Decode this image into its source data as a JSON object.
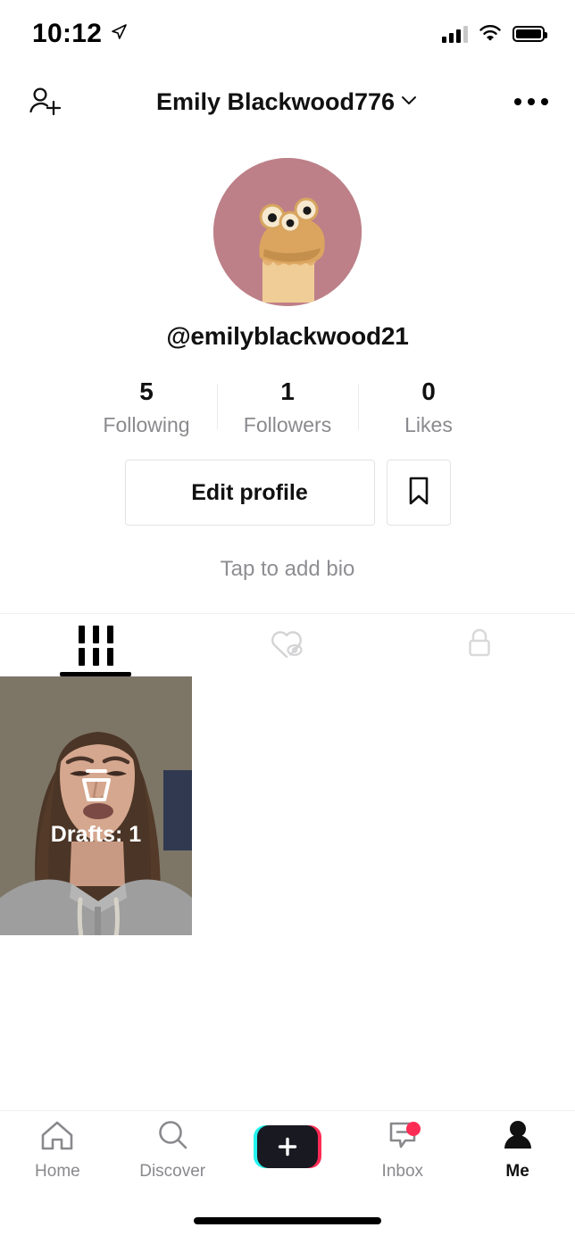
{
  "status_bar": {
    "time": "10:12",
    "location_icon": "location-arrow-icon",
    "signal_icon": "cellular-signal-icon",
    "wifi_icon": "wifi-icon",
    "battery_icon": "battery-full-icon"
  },
  "header": {
    "add_friend_icon": "add-person-icon",
    "title": "Emily Blackwood776",
    "chevron_icon": "chevron-down-icon",
    "more_icon": "more-options-icon"
  },
  "profile": {
    "avatar_icon": "avatar-cartoon-character",
    "avatar_bg_color": "#bd8088",
    "username": "@emilyblackwood21",
    "stats": [
      {
        "value": "5",
        "label": "Following"
      },
      {
        "value": "1",
        "label": "Followers"
      },
      {
        "value": "0",
        "label": "Likes"
      }
    ],
    "edit_profile_label": "Edit profile",
    "bookmark_icon": "bookmark-icon",
    "bio_placeholder": "Tap to add bio"
  },
  "content_tabs": [
    {
      "name": "videos",
      "icon": "grid-icon",
      "active": true
    },
    {
      "name": "liked",
      "icon": "heart-hidden-icon",
      "active": false
    },
    {
      "name": "private",
      "icon": "lock-icon",
      "active": false
    }
  ],
  "video_grid": {
    "drafts": {
      "icon": "drafts-icon",
      "label": "Drafts: 1"
    }
  },
  "bottom_nav": [
    {
      "label": "Home",
      "icon": "home-icon",
      "active": false,
      "badge": false
    },
    {
      "label": "Discover",
      "icon": "search-icon",
      "active": false,
      "badge": false
    },
    {
      "label": "",
      "icon": "create-plus-icon",
      "active": false,
      "badge": false
    },
    {
      "label": "Inbox",
      "icon": "inbox-message-icon",
      "active": false,
      "badge": true
    },
    {
      "label": "Me",
      "icon": "person-icon",
      "active": true,
      "badge": false
    }
  ],
  "colors": {
    "accent_cyan": "#25f4ee",
    "accent_pink": "#fe2c55",
    "text_primary": "#111111",
    "text_secondary": "#8a8a8e"
  }
}
